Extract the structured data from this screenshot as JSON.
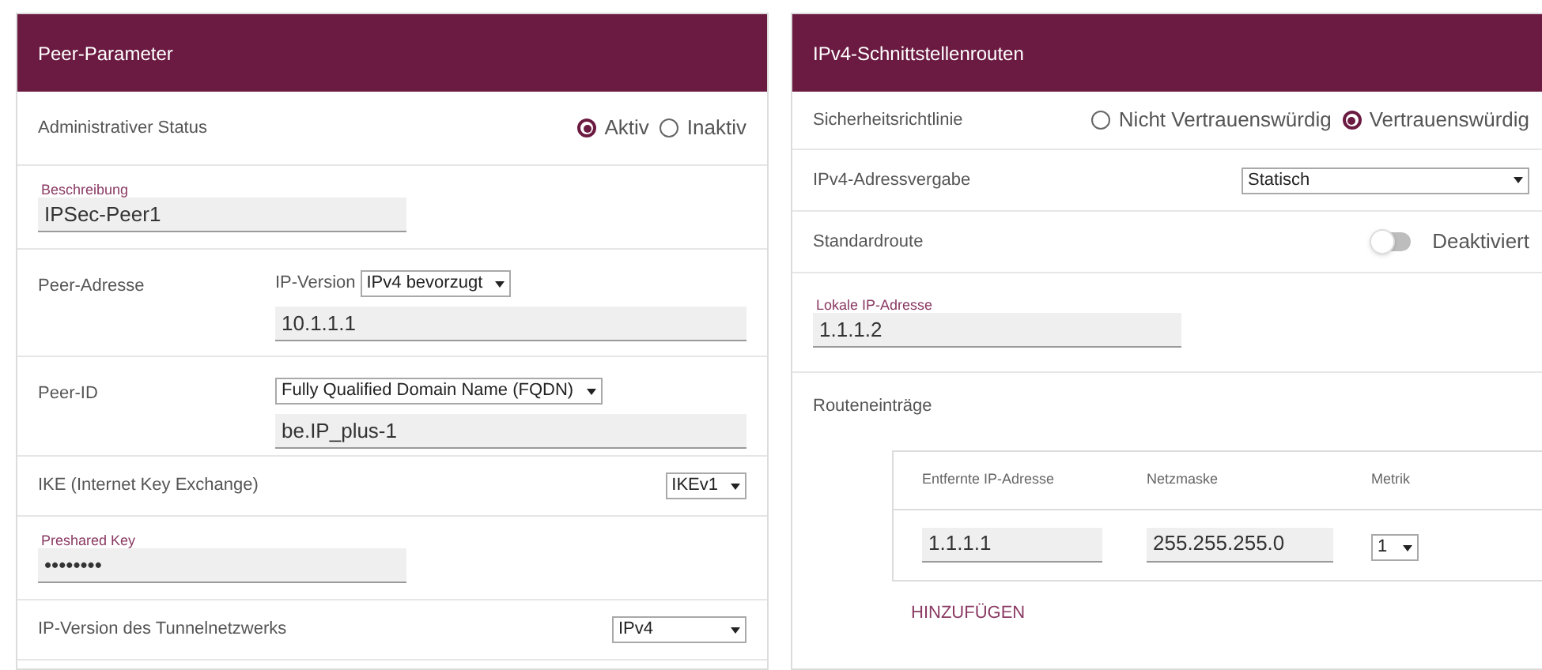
{
  "panels": [
    {
      "title": "Peer-Parameter",
      "rows": [
        {
          "kind": "radio",
          "label": "Administrativer Status",
          "options": [
            {
              "label": "Aktiv",
              "selected": true
            },
            {
              "label": "Inaktiv",
              "selected": false
            }
          ]
        },
        {
          "kind": "floating",
          "label": "Beschreibung",
          "value": "IPSec-Peer1"
        },
        {
          "kind": "combo",
          "label": "Peer-Adresse",
          "select_label": "IP-Version",
          "select": "IPv4 bevorzugt",
          "value": "10.1.1.1"
        },
        {
          "kind": "combo",
          "label": "Peer-ID",
          "select": "Fully Qualified Domain Name (FQDN)",
          "value": "be.IP_plus-1"
        },
        {
          "kind": "select",
          "label": "IKE (Internet Key Exchange)",
          "select": "IKEv1"
        },
        {
          "kind": "floating",
          "label": "Preshared Key",
          "value": "••••••••"
        },
        {
          "kind": "select",
          "label": "IP-Version des Tunnelnetzwerks",
          "select": "IPv4"
        }
      ]
    },
    {
      "title": "IPv4-Schnittstellenrouten",
      "rows": [
        {
          "kind": "radio",
          "label": "Sicherheitsrichtlinie",
          "options": [
            {
              "label": "Nicht Vertrauenswürdig",
              "selected": false
            },
            {
              "label": "Vertrauenswürdig",
              "selected": true
            }
          ]
        },
        {
          "kind": "select",
          "label": "IPv4-Adressvergabe",
          "select": "Statisch"
        },
        {
          "kind": "toggle",
          "label": "Standardroute",
          "on": false,
          "state_label": "Deaktiviert"
        },
        {
          "kind": "floating",
          "label": "Lokale IP-Adresse",
          "value": "1.1.1.2"
        },
        {
          "kind": "routes",
          "label": "Routeneinträge",
          "columns": [
            "Entfernte IP-Adresse",
            "Netzmaske",
            "Metrik"
          ],
          "rows": [
            {
              "remote": "1.1.1.1",
              "mask": "255.255.255.0",
              "metric": "1"
            }
          ],
          "add": "HINZUFÜGEN"
        }
      ]
    }
  ]
}
